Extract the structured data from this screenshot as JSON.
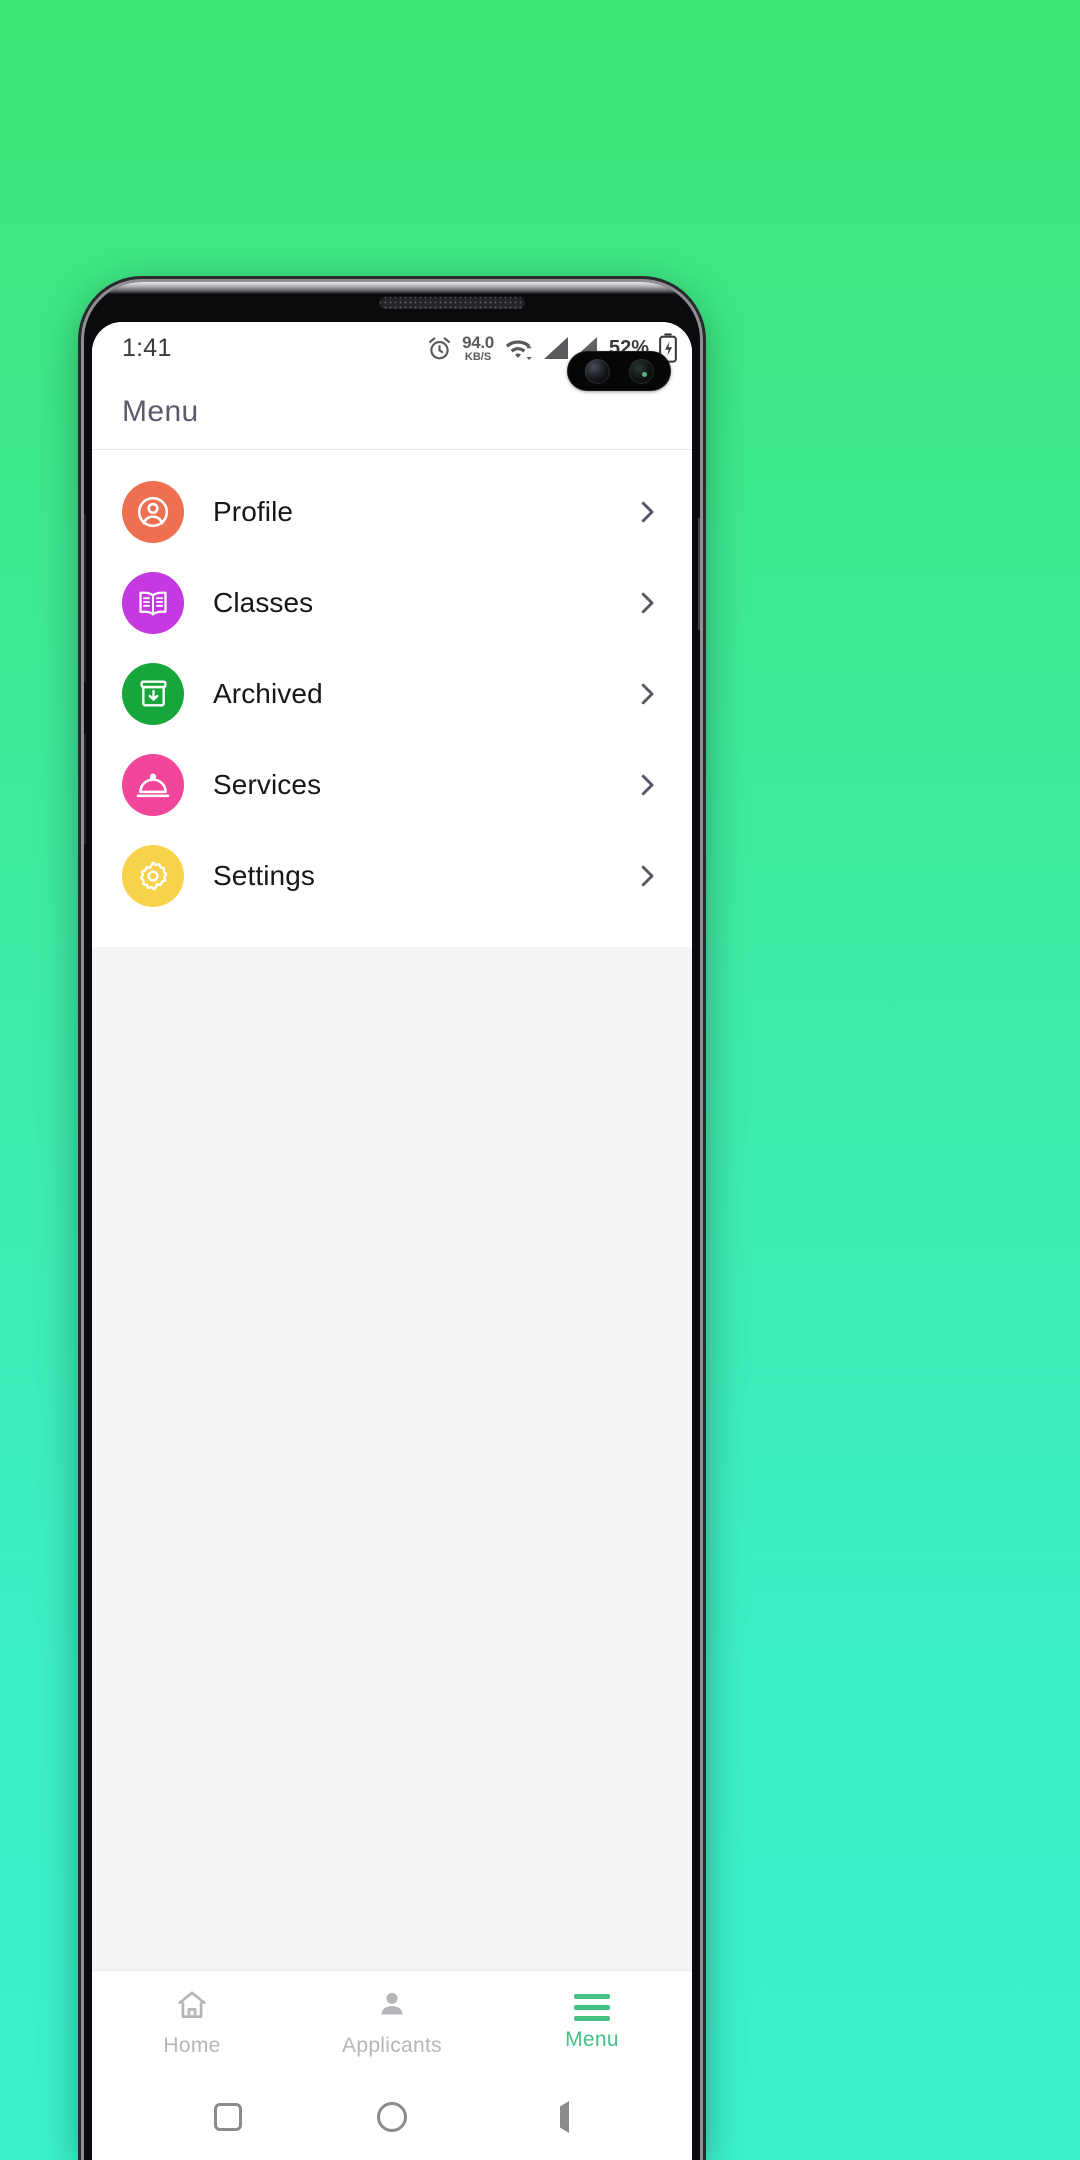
{
  "wallpaper": {
    "gradient_top": "#3ee87a",
    "gradient_bottom": "#3bf2cd"
  },
  "statusbar": {
    "time": "1:41",
    "alarm_icon": "alarm-clock-icon",
    "network_speed_value": "94.0",
    "network_speed_unit": "KB/S",
    "wifi_icon": "wifi-icon",
    "signal_icon": "cellular-signal-icon",
    "battery_percent": "52%",
    "battery_icon": "battery-charging-icon"
  },
  "appbar": {
    "title": "Menu"
  },
  "menu": {
    "items": [
      {
        "label": "Profile",
        "icon": "account-circle-icon",
        "color": "#ee7050",
        "chevron": "chevron-right-icon"
      },
      {
        "label": "Classes",
        "icon": "open-book-icon",
        "color": "#c43ae0",
        "chevron": "chevron-right-icon"
      },
      {
        "label": "Archived",
        "icon": "archive-box-icon",
        "color": "#17a63a",
        "chevron": "chevron-right-icon"
      },
      {
        "label": "Services",
        "icon": "room-service-bell-icon",
        "color": "#f2469b",
        "chevron": "chevron-right-icon"
      },
      {
        "label": "Settings",
        "icon": "gear-icon",
        "color": "#f7d24a",
        "chevron": "chevron-right-icon"
      }
    ]
  },
  "bottom_nav": {
    "active_color": "#45c186",
    "inactive_color": "#b6b6ba",
    "items": [
      {
        "label": "Home",
        "icon": "home-icon",
        "active": false
      },
      {
        "label": "Applicants",
        "icon": "person-icon",
        "active": false
      },
      {
        "label": "Menu",
        "icon": "hamburger-icon",
        "active": true
      }
    ]
  },
  "android_nav": {
    "recents": "square-recents-icon",
    "home": "circle-home-icon",
    "back": "triangle-back-icon"
  }
}
